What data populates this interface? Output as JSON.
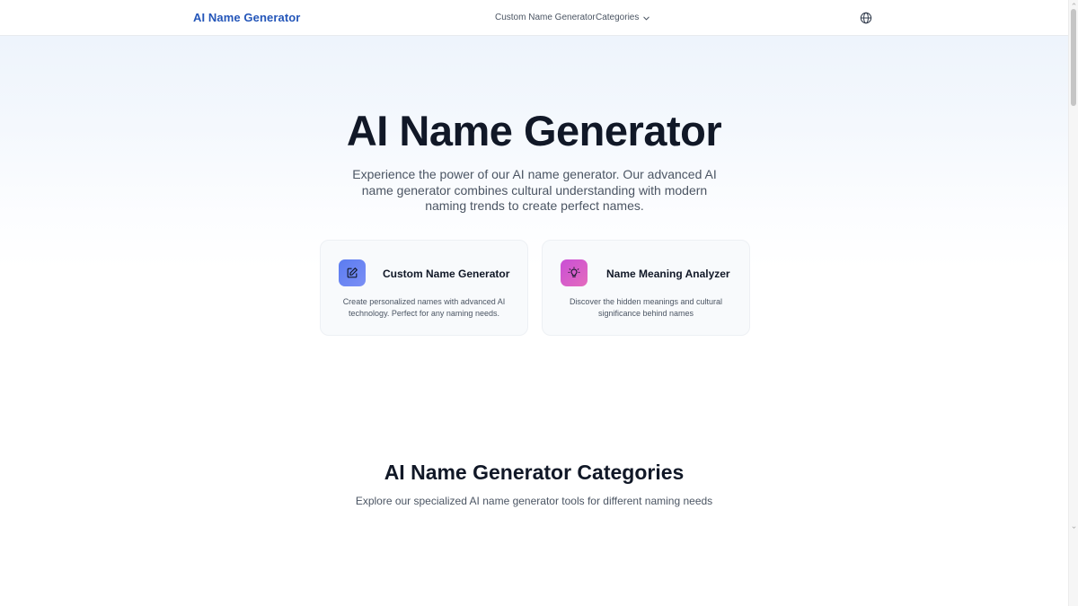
{
  "header": {
    "logo": "AI Name Generator",
    "nav": {
      "custom": "Custom Name Generator",
      "categories": "Categories"
    },
    "language_icon": "globe-icon"
  },
  "hero": {
    "title": "AI Name Generator",
    "description": "Experience the power of our AI name generator. Our advanced AI name generator combines cultural understanding with modern naming trends to create perfect names."
  },
  "cards": [
    {
      "title": "Custom Name Generator",
      "description": "Create personalized names with advanced AI technology. Perfect for any naming needs.",
      "icon": "edit-icon",
      "color": "#6b84f2"
    },
    {
      "title": "Name Meaning Analyzer",
      "description": "Discover the hidden meanings and cultural significance behind names",
      "icon": "lightbulb-icon",
      "color": "#d65bcb"
    }
  ],
  "categories": {
    "title": "AI Name Generator Categories",
    "subtitle": "Explore our specialized AI name generator tools for different naming needs"
  },
  "colors": {
    "brand": "#2456b9",
    "text": "#111827",
    "muted": "#4b5563"
  }
}
